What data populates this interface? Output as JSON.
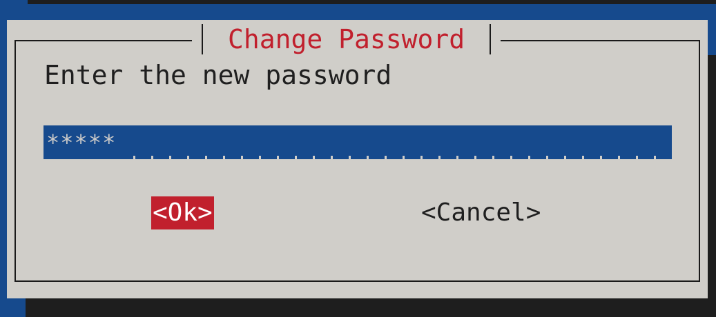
{
  "dialog": {
    "title": "Change Password",
    "prompt": "Enter the new password",
    "password_value": "*****",
    "ok_label": "<Ok>",
    "cancel_label": "<Cancel>"
  },
  "colors": {
    "background": "#164a8d",
    "dialog": "#d0cec9",
    "title": "#c1202d",
    "focused_button": "#c1202d",
    "shadow": "#1e1e1e"
  }
}
